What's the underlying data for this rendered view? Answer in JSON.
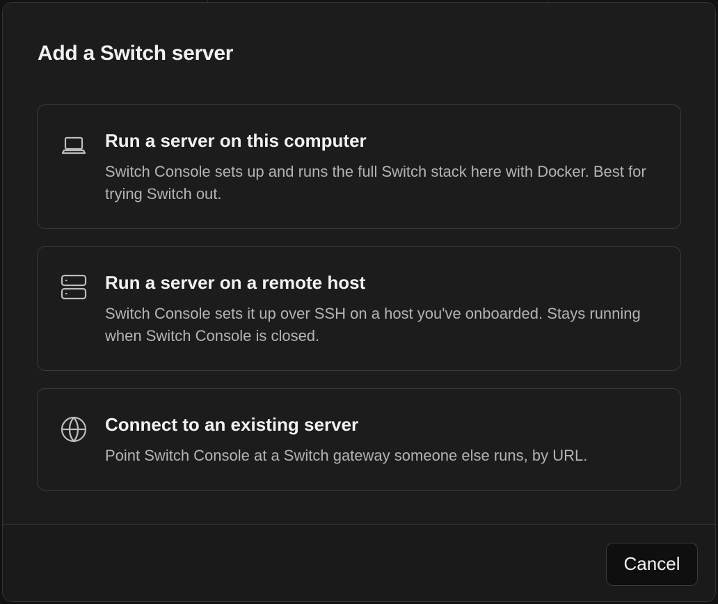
{
  "dialog": {
    "title": "Add a Switch server",
    "options": [
      {
        "icon": "laptop-icon",
        "title": "Run a server on this computer",
        "description": "Switch Console sets up and runs the full Switch stack here with Docker. Best for trying Switch out."
      },
      {
        "icon": "server-icon",
        "title": "Run a server on a remote host",
        "description": "Switch Console sets it up over SSH on a host you've onboarded. Stays running when Switch Console is closed."
      },
      {
        "icon": "globe-icon",
        "title": "Connect to an existing server",
        "description": "Point Switch Console at a Switch gateway someone else runs, by URL."
      }
    ],
    "cancel_label": "Cancel"
  },
  "colors": {
    "dialog_background": "#1c1c1c",
    "card_border": "#3a3a3a",
    "title_text": "#f2f2f2",
    "description_text": "#b4b4b4"
  }
}
